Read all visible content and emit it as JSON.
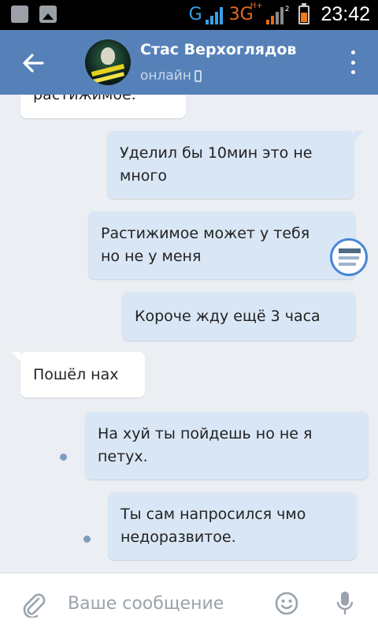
{
  "status_bar": {
    "network_g": "G",
    "network_3g": "3G",
    "network_hplus": "H+",
    "sim_slot": "2",
    "time": "23:42",
    "accent_blue": "#3aa0e8",
    "accent_orange": "#e46b1e"
  },
  "header": {
    "contact_name": "Стас Верхоглядов",
    "status": "онлайн",
    "bg_color": "#5681b8"
  },
  "messages": [
    {
      "direction": "in",
      "text": "растижимое."
    },
    {
      "direction": "out",
      "lines": [
        "Уделил бы 10мин это не",
        "много"
      ]
    },
    {
      "direction": "out",
      "lines": [
        "Растижимое может у тебя",
        "но не у меня"
      ]
    },
    {
      "direction": "out",
      "text": "Короче жду ещё 3 часа"
    },
    {
      "direction": "in",
      "text": "Пошёл нах"
    },
    {
      "direction": "out",
      "lines": [
        "На хуй ты пойдешь но не я",
        "петух."
      ],
      "unread": true
    },
    {
      "direction": "out",
      "lines": [
        "Ты сам напросился чмо",
        "недоразвитое."
      ],
      "unread": true
    }
  ],
  "composer": {
    "placeholder": "Ваше сообщение",
    "icons": [
      "paperclip-icon",
      "smile-icon",
      "microphone-icon"
    ]
  }
}
